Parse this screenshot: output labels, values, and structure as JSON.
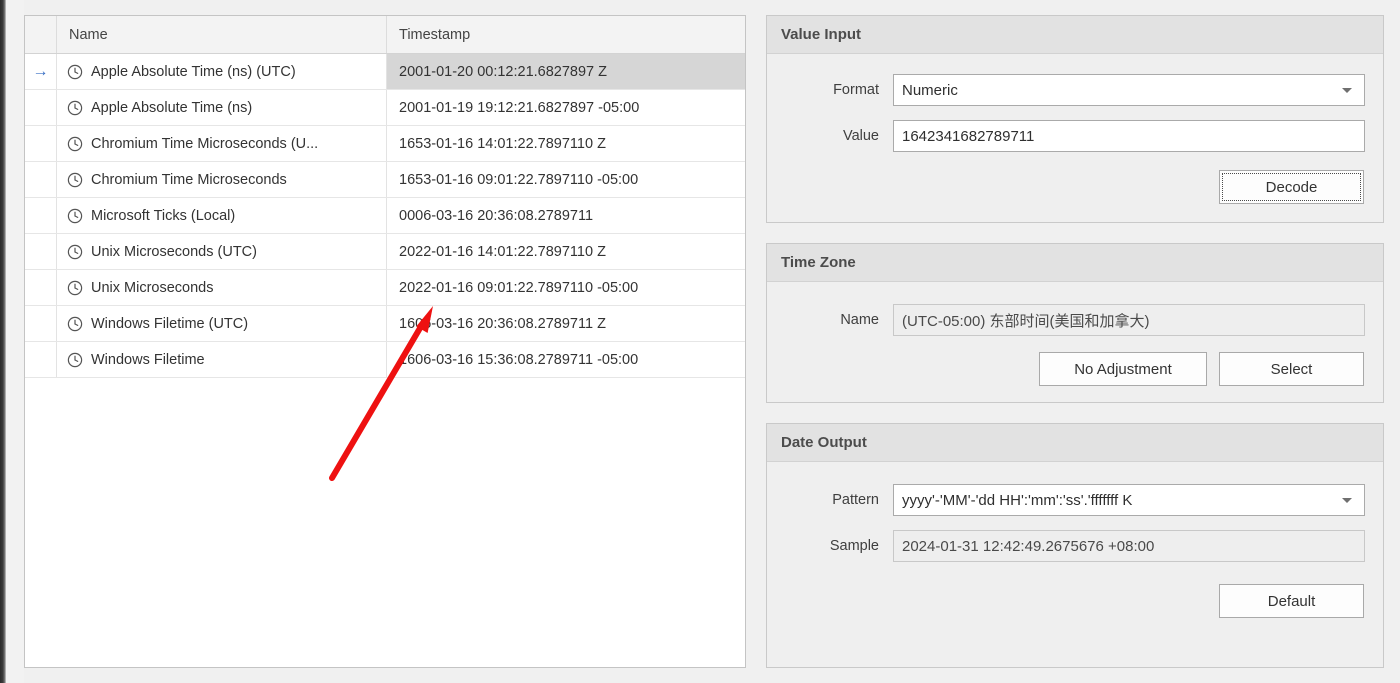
{
  "grid": {
    "columns": [
      "Name",
      "Timestamp"
    ],
    "rows": [
      {
        "icon": "clock-icon",
        "name": "Apple Absolute Time (ns) (UTC)",
        "timestamp": "2001-01-20 00:12:21.6827897 Z",
        "selected": true,
        "indicator": "→"
      },
      {
        "icon": "clock-icon",
        "name": "Apple Absolute Time (ns)",
        "timestamp": "2001-01-19 19:12:21.6827897 -05:00",
        "selected": false,
        "indicator": ""
      },
      {
        "icon": "clock-icon",
        "name": "Chromium Time Microseconds (U...",
        "timestamp": "1653-01-16 14:01:22.7897110 Z",
        "selected": false,
        "indicator": ""
      },
      {
        "icon": "clock-icon",
        "name": "Chromium Time Microseconds",
        "timestamp": "1653-01-16 09:01:22.7897110 -05:00",
        "selected": false,
        "indicator": ""
      },
      {
        "icon": "clock-icon",
        "name": "Microsoft Ticks (Local)",
        "timestamp": "0006-03-16 20:36:08.2789711",
        "selected": false,
        "indicator": ""
      },
      {
        "icon": "clock-icon",
        "name": "Unix Microseconds (UTC)",
        "timestamp": "2022-01-16 14:01:22.7897110 Z",
        "selected": false,
        "indicator": ""
      },
      {
        "icon": "clock-icon",
        "name": "Unix Microseconds",
        "timestamp": "2022-01-16 09:01:22.7897110 -05:00",
        "selected": false,
        "indicator": ""
      },
      {
        "icon": "clock-icon",
        "name": "Windows Filetime (UTC)",
        "timestamp": "1606-03-16 20:36:08.2789711 Z",
        "selected": false,
        "indicator": ""
      },
      {
        "icon": "clock-icon",
        "name": "Windows Filetime",
        "timestamp": "1606-03-16 15:36:08.2789711 -05:00",
        "selected": false,
        "indicator": ""
      }
    ]
  },
  "value_input": {
    "title": "Value Input",
    "format_label": "Format",
    "format_value": "Numeric",
    "value_label": "Value",
    "value_value": "1642341682789711",
    "decode_label": "Decode"
  },
  "time_zone": {
    "title": "Time Zone",
    "name_label": "Name",
    "name_value": "(UTC-05:00) 东部时间(美国和加拿大)",
    "no_adjustment_label": "No Adjustment",
    "select_label": "Select"
  },
  "date_output": {
    "title": "Date Output",
    "pattern_label": "Pattern",
    "pattern_value": "yyyy'-'MM'-'dd HH':'mm':'ss'.'fffffff K",
    "sample_label": "Sample",
    "sample_value": "2024-01-31 12:42:49.2675676 +08:00",
    "default_label": "Default"
  },
  "annotation": {
    "arrow_color": "#ee1111",
    "arrow_from": "332,478",
    "arrow_to": "433,306"
  },
  "colors": {
    "selection": "#d6d6d6",
    "row_indicator": "#3a6fc4",
    "group_header": "#e2e2e2",
    "panel_bg": "#efefef",
    "window_bg": "#f0f0f0"
  }
}
